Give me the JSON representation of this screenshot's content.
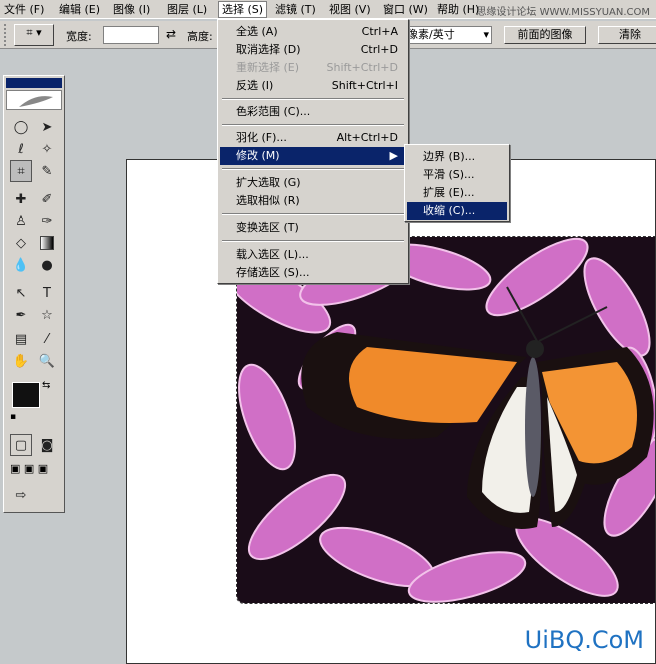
{
  "menubar": {
    "items": [
      "文件 (F)",
      "编辑 (E)",
      "图像 (I)",
      "图层 (L)",
      "选择 (S)",
      "滤镜 (T)",
      "视图 (V)",
      "窗口 (W)",
      "帮助 (H)"
    ],
    "site": "思缘设计论坛  WWW.MISSYUAN.COM"
  },
  "options": {
    "width_label": "宽度:",
    "height_label": "高度:",
    "resolution_unit": "像素/英寸",
    "front_image_button": "前面的图像",
    "clear_button": "清除"
  },
  "select_menu": {
    "items": [
      {
        "label": "全选 (A)",
        "shortcut": "Ctrl+A"
      },
      {
        "label": "取消选择 (D)",
        "shortcut": "Ctrl+D"
      },
      {
        "label": "重新选择 (E)",
        "shortcut": "Shift+Ctrl+D",
        "disabled": true
      },
      {
        "label": "反选 (I)",
        "shortcut": "Shift+Ctrl+I"
      },
      {
        "label": "色彩范围 (C)...",
        "shortcut": ""
      },
      {
        "label": "羽化 (F)...",
        "shortcut": "Alt+Ctrl+D"
      },
      {
        "label": "修改 (M)",
        "shortcut": ""
      },
      {
        "label": "扩大选取 (G)",
        "shortcut": ""
      },
      {
        "label": "选取相似 (R)",
        "shortcut": ""
      },
      {
        "label": "变换选区 (T)",
        "shortcut": ""
      },
      {
        "label": "载入选区 (L)...",
        "shortcut": ""
      },
      {
        "label": "存储选区 (S)...",
        "shortcut": ""
      }
    ]
  },
  "modify_submenu": {
    "items": [
      "边界 (B)...",
      "平滑 (S)...",
      "扩展 (E)...",
      "收缩 (C)..."
    ]
  },
  "watermark": "UiBQ.CoM",
  "colors": {
    "accent": "#0a246a",
    "menu_bg": "#d6d3ce",
    "flower": "#c75bc0"
  }
}
